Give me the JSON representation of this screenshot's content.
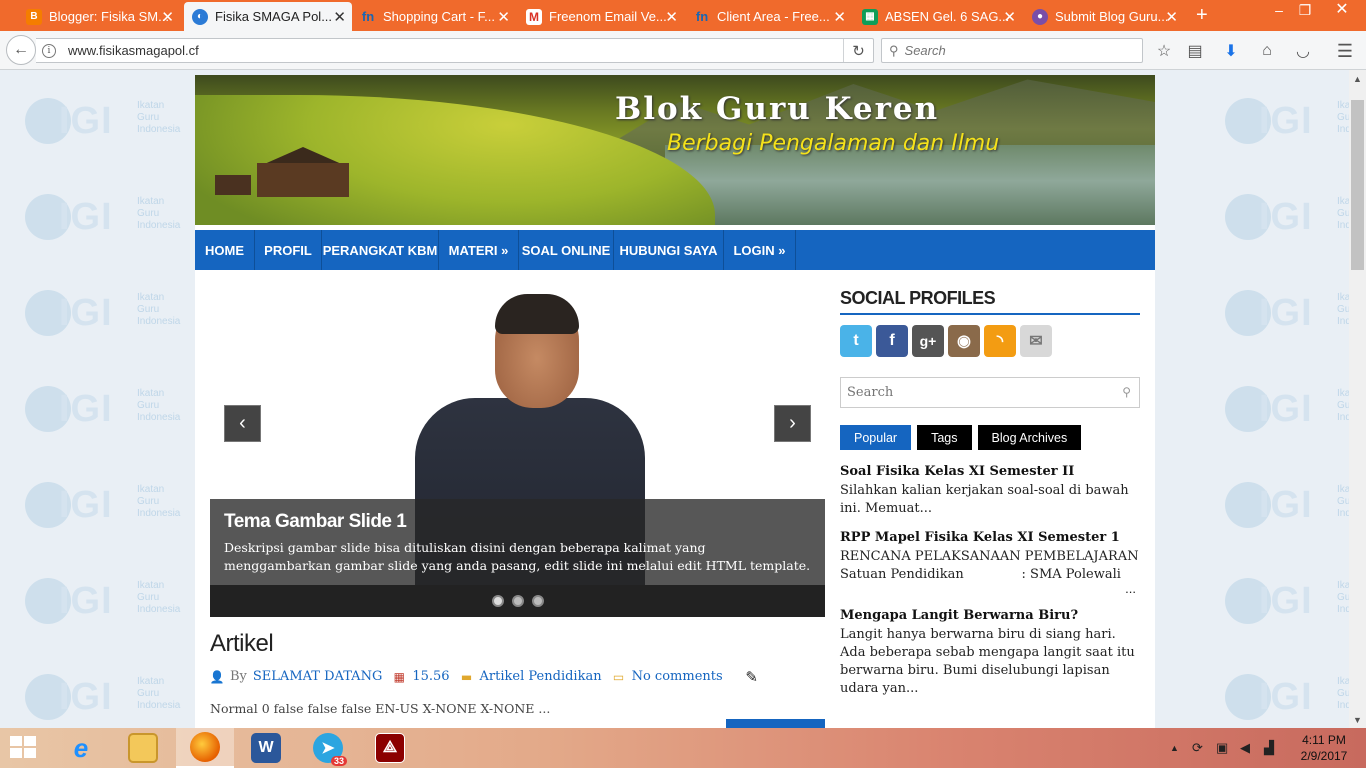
{
  "browser": {
    "tabs": [
      {
        "label": "Blogger: Fisika SM...",
        "icon": "blogger-icon",
        "color": "#f57d00"
      },
      {
        "label": "Fisika SMAGA Pol...",
        "icon": "globe-icon",
        "color": "#2b7bd6",
        "active": true
      },
      {
        "label": "Shopping Cart - F...",
        "icon": "freenom-icon",
        "color": "#1a66b3"
      },
      {
        "label": "Freenom Email Ve...",
        "icon": "gmail-icon",
        "color": "#d93025"
      },
      {
        "label": "Client Area - Free...",
        "icon": "freenom-icon",
        "color": "#1a66b3"
      },
      {
        "label": "ABSEN Gel. 6 SAG...",
        "icon": "sheets-icon",
        "color": "#0f9d58"
      },
      {
        "label": "Submit Blog Guru...",
        "icon": "user-icon",
        "color": "#7a4ea8"
      }
    ],
    "url": "www.fisikasmagapol.cf",
    "search_placeholder": "Search"
  },
  "site": {
    "title": "Blok Guru Keren",
    "subtitle": "Berbagi Pengalaman dan Ilmu",
    "menu": [
      "HOME",
      "PROFIL",
      "PERANGKAT KBM",
      "MATERI »",
      "SOAL ONLINE",
      "HUBUNGI SAYA",
      "LOGIN »"
    ],
    "slider": {
      "title": "Tema Gambar Slide 1",
      "description": "Deskripsi gambar slide bisa dituliskan disini dengan beberapa kalimat yang menggambarkan gambar slide yang anda pasang, edit slide ini melalui edit HTML template.",
      "prev": "‹",
      "next": "›"
    },
    "article": {
      "title": "Artikel",
      "by": "By",
      "author": "SELAMAT DATANG",
      "time": "15.56",
      "category": "Artikel Pendidikan",
      "comments": "No comments",
      "excerpt": "Normal 0 false false false EN-US X-NONE X-NONE ..."
    },
    "sidebar": {
      "social_title": "SOCIAL PROFILES",
      "search_placeholder": "Search",
      "tabs": [
        "Popular",
        "Tags",
        "Blog Archives"
      ],
      "posts": [
        {
          "title": "Soal Fisika Kelas XI Semester II",
          "excerpt": "Silahkan kalian kerjakan soal-soal di bawah ini. Memuat..."
        },
        {
          "title": "RPP Mapel Fisika Kelas XI Semester 1",
          "excerpt": "RENCANA PELAKSANAAN PEMBELAJARAN Satuan Pendidikan              : SMA Polewali",
          "more": "..."
        },
        {
          "title": "Mengapa Langit Berwarna Biru?",
          "excerpt": "Langit hanya berwarna biru di siang hari. Ada beberapa sebab mengapa langit saat itu berwarna biru. Bumi diselubungi lapisan udara yan..."
        }
      ]
    }
  },
  "watermark": {
    "brand": "IGI",
    "text": "Ikatan Guru Indonesia"
  },
  "taskbar": {
    "time": "4:11 PM",
    "date": "2/9/2017",
    "telegram_badge": "33"
  },
  "colors": {
    "accent": "#1565c0",
    "tabbar": "#f06a2c"
  }
}
